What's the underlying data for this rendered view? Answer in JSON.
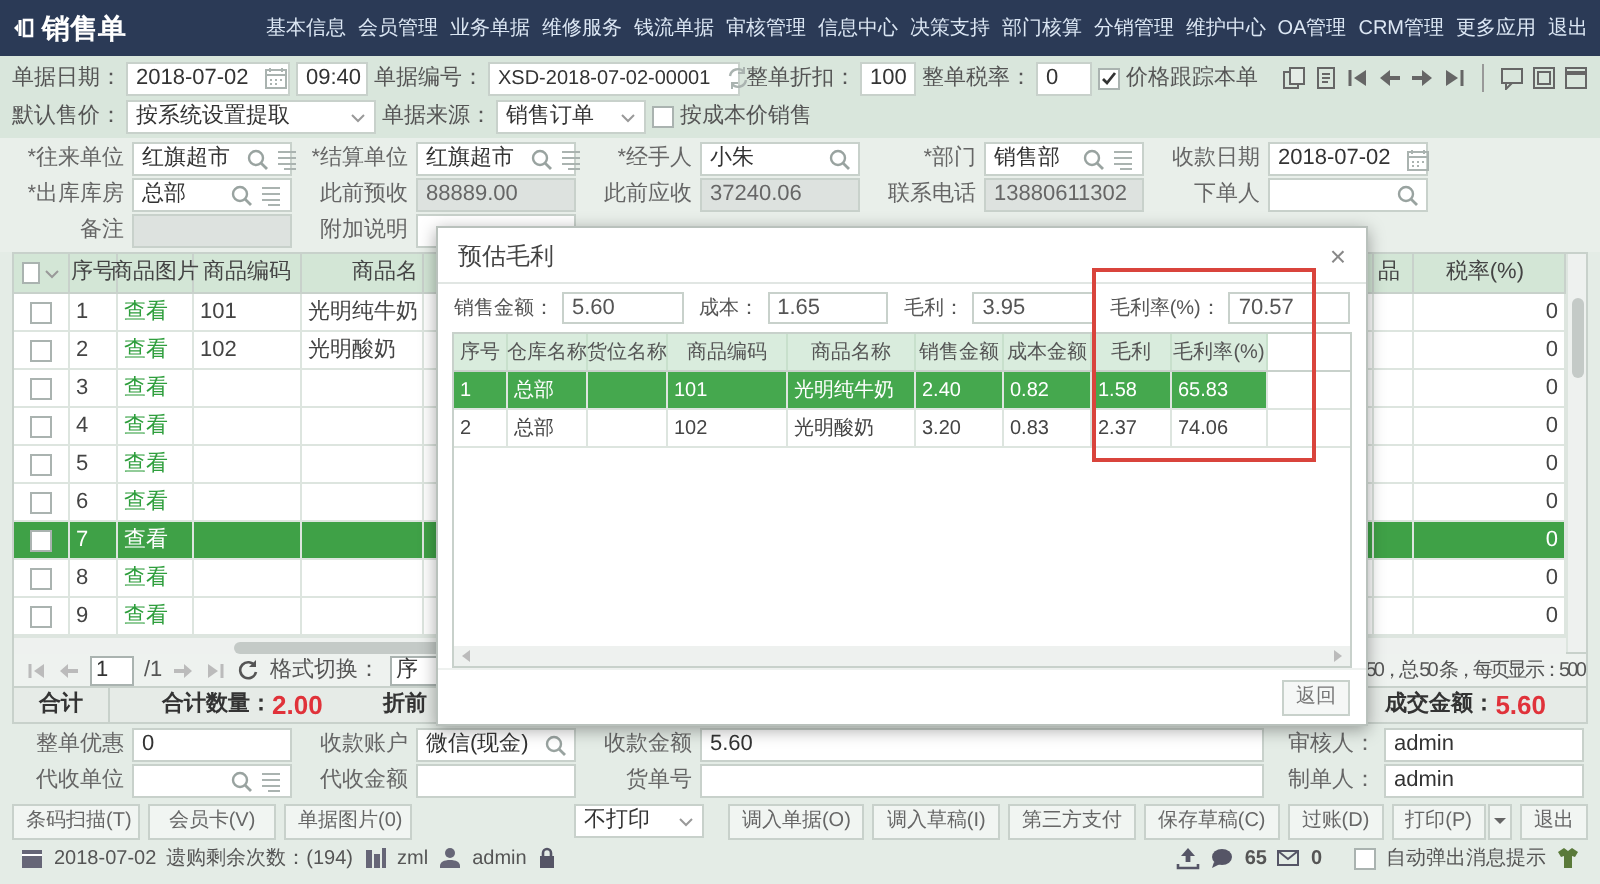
{
  "window": {
    "title": "销售单"
  },
  "menu": [
    "基本信息",
    "会员管理",
    "业务单据",
    "维修服务",
    "钱流单据",
    "审核管理",
    "信息中心",
    "决策支持",
    "部门核算",
    "分销管理",
    "维护中心",
    "OA管理",
    "CRM管理",
    "更多应用",
    "退出"
  ],
  "toolbar_row_1": [
    {
      "kind": "date",
      "label": "单据日期：",
      "value": "2018-07-02"
    },
    {
      "kind": "plain",
      "value": "09:40"
    },
    {
      "kind": "refresh",
      "label": "单据编号：",
      "value": "XSD-2018-07-02-00001"
    },
    {
      "kind": "plain",
      "label": "整单折扣：",
      "value": "100"
    },
    {
      "kind": "plain",
      "label": "整单税率：",
      "value": "0"
    },
    {
      "kind": "checkbox",
      "label": "价格跟踪本单",
      "checked": true
    }
  ],
  "toolbar_row_2": [
    {
      "kind": "select",
      "label": "默认售价：",
      "value": "按系统设置提取"
    },
    {
      "kind": "select",
      "label": "单据来源：",
      "value": "销售订单"
    },
    {
      "kind": "checkbox",
      "label": "按成本价销售",
      "checked": false
    }
  ],
  "header_fields": [
    {
      "kind": "search_list",
      "label": "*往来单位",
      "value": "红旗超市",
      "disabled": false
    },
    {
      "kind": "search_list",
      "label": "*结算单位",
      "value": "红旗超市",
      "disabled": false
    },
    {
      "kind": "search",
      "label": "*经手人",
      "value": "小朱",
      "disabled": false
    },
    {
      "kind": "search_list",
      "label": "*部门",
      "value": "销售部",
      "disabled": false
    },
    {
      "kind": "date",
      "label": "收款日期",
      "value": "2018-07-02",
      "disabled": false
    },
    {
      "kind": "search_list",
      "label": "*出库库房",
      "value": "总部",
      "disabled": false
    },
    {
      "kind": "plain",
      "label": "此前预收",
      "value": "88889.00",
      "disabled": true
    },
    {
      "kind": "plain",
      "label": "此前应收",
      "value": "37240.06",
      "disabled": true
    },
    {
      "kind": "plain",
      "label": "联系电话",
      "value": "13880611302",
      "disabled": true
    },
    {
      "kind": "search",
      "label": "下单人",
      "disabled": false
    },
    {
      "kind": "plain",
      "label": "备注",
      "disabled": true
    },
    {
      "kind": "plain",
      "label": "附加说明",
      "disabled": false
    }
  ],
  "table": {
    "select_all_checked": false,
    "columns": [
      "序号",
      "商品图片",
      "商品编码",
      "商品名",
      "品",
      "税率(%)"
    ],
    "rows": [
      {
        "seq": "1",
        "picture": "查看",
        "code": "101",
        "name": "光明纯牛奶",
        "tax": "0",
        "checked": false,
        "selected": false
      },
      {
        "seq": "2",
        "picture": "查看",
        "code": "102",
        "name": "光明酸奶",
        "tax": "0",
        "checked": false,
        "selected": false
      },
      {
        "seq": "3",
        "picture": "查看",
        "tax": "0",
        "checked": false,
        "selected": false
      },
      {
        "seq": "4",
        "picture": "查看",
        "tax": "0",
        "checked": false,
        "selected": false
      },
      {
        "seq": "5",
        "picture": "查看",
        "tax": "0",
        "checked": false,
        "selected": false
      },
      {
        "seq": "6",
        "picture": "查看",
        "tax": "0",
        "checked": false,
        "selected": false
      },
      {
        "seq": "7",
        "picture": "查看",
        "tax": "0",
        "checked": false,
        "selected": true
      },
      {
        "seq": "8",
        "picture": "查看",
        "tax": "0",
        "checked": false,
        "selected": false
      },
      {
        "seq": "9",
        "picture": "查看",
        "tax": "0",
        "checked": false,
        "selected": false
      }
    ]
  },
  "pager": {
    "page": "1",
    "pages": "/1",
    "format_label": "格式切换：",
    "format_value": "序",
    "summary": "50，总 50 条，每页显示：500"
  },
  "totals": {
    "label": "合计",
    "quantity_label": "合计数量：",
    "quantity": "2.00",
    "discount_label": "折前",
    "amount_label": "成交金额：",
    "amount": "5.60"
  },
  "footer_fields": [
    {
      "kind": "plain",
      "label": "整单优惠",
      "value": "0"
    },
    {
      "kind": "search",
      "label": "收款账户",
      "value": "微信(现金)"
    },
    {
      "kind": "plain",
      "label": "收款金额",
      "value": "5.60"
    },
    {
      "kind": "plain",
      "label": "审核人：",
      "value": "admin"
    },
    {
      "kind": "search_list",
      "label": "代收单位"
    },
    {
      "kind": "plain",
      "label": "代收金额"
    },
    {
      "kind": "plain",
      "label": "货单号"
    },
    {
      "kind": "plain",
      "label": "制单人：",
      "value": "admin"
    }
  ],
  "buttons_left": [
    "条码扫描(T)",
    "会员卡(V)",
    "单据图片(0)"
  ],
  "print_select": "不打印",
  "buttons_right": [
    {
      "kind": "button",
      "label": "调入单据(O)"
    },
    {
      "kind": "button",
      "label": "调入草稿(I)"
    },
    {
      "kind": "button",
      "label": "第三方支付"
    },
    {
      "kind": "button",
      "label": "保存草稿(C)"
    },
    {
      "kind": "button",
      "label": "过账(D)"
    },
    {
      "kind": "split",
      "label": "打印(P)"
    },
    {
      "kind": "button",
      "label": "退出"
    }
  ],
  "status_bar": {
    "date": "2018-07-02",
    "remaining": "遗购剩余次数：(194)",
    "company": "zml",
    "user": "admin",
    "messages": "65",
    "mail": "0",
    "auto_popup": {
      "label": "自动弹出消息提示",
      "checked": false
    }
  },
  "dialog": {
    "title": "预估毛利",
    "close": "×",
    "summary": [
      {
        "label": "销售金额：",
        "value": "5.60"
      },
      {
        "label": "成本：",
        "value": "1.65"
      },
      {
        "label": "毛利：",
        "value": "3.95"
      },
      {
        "label": "毛利率(%)：",
        "value": "70.57"
      }
    ],
    "columns": [
      "序号",
      "仓库名称",
      "货位名称",
      "商品编码",
      "商品名称",
      "销售金额",
      "成本金额",
      "毛利",
      "毛利率(%)"
    ],
    "rows": [
      {
        "seq": "1",
        "warehouse": "总部",
        "code": "101",
        "name": "光明纯牛奶",
        "sales": "2.40",
        "cost": "0.82",
        "profit": "1.58",
        "rate": "65.83",
        "selected": true
      },
      {
        "seq": "2",
        "warehouse": "总部",
        "code": "102",
        "name": "光明酸奶",
        "sales": "3.20",
        "cost": "0.83",
        "profit": "2.37",
        "rate": "74.06",
        "selected": false
      }
    ],
    "back_button": "返回"
  }
}
